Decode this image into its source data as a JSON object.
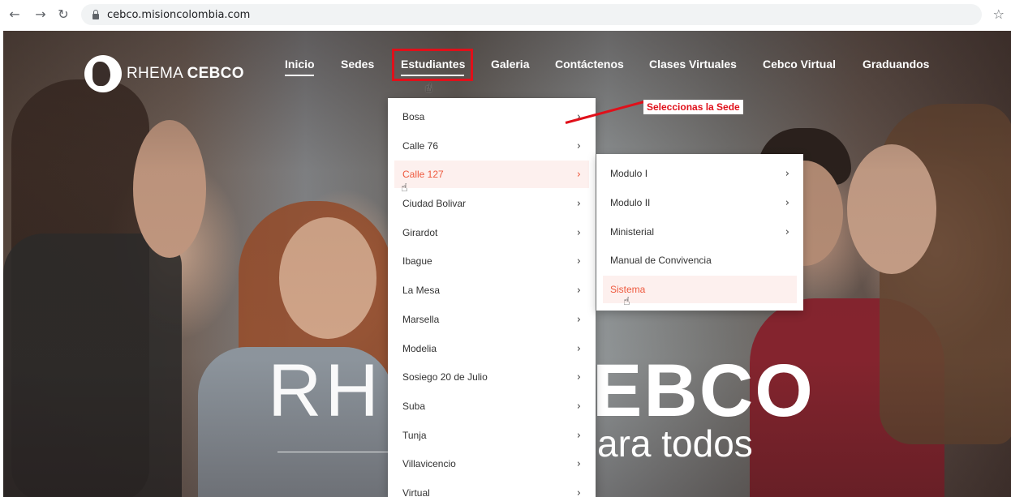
{
  "browser": {
    "back_icon": "back-arrow-icon",
    "forward_icon": "forward-arrow-icon",
    "reload_icon": "reload-icon",
    "url": "cebco.misioncolombia.com"
  },
  "header": {
    "logo_light": "RHEMA ",
    "logo_bold": "CEBCO",
    "nav": [
      {
        "label": "Inicio"
      },
      {
        "label": "Sedes"
      },
      {
        "label": "Estudiantes"
      },
      {
        "label": "Galeria"
      },
      {
        "label": "Contáctenos"
      },
      {
        "label": "Clases Virtuales"
      },
      {
        "label": "Cebco Virtual"
      },
      {
        "label": "Graduandos"
      }
    ]
  },
  "dropdown": {
    "items": [
      {
        "label": "Bosa"
      },
      {
        "label": "Calle 76"
      },
      {
        "label": "Calle 127"
      },
      {
        "label": "Ciudad Bolivar"
      },
      {
        "label": "Girardot"
      },
      {
        "label": "Ibague"
      },
      {
        "label": "La Mesa"
      },
      {
        "label": "Marsella"
      },
      {
        "label": "Modelia"
      },
      {
        "label": "Sosiego 20 de Julio"
      },
      {
        "label": "Suba"
      },
      {
        "label": "Tunja"
      },
      {
        "label": "Villavicencio"
      },
      {
        "label": "Virtual"
      }
    ],
    "active_index": 2,
    "chevron": "›"
  },
  "submenu": {
    "items": [
      {
        "label": "Modulo I",
        "has_arrow": true
      },
      {
        "label": "Modulo II",
        "has_arrow": true
      },
      {
        "label": "Ministerial",
        "has_arrow": true
      },
      {
        "label": "Manual de Convivencia",
        "has_arrow": false
      },
      {
        "label": "Sistema",
        "has_arrow": false
      }
    ],
    "active_index": 4
  },
  "annotation": {
    "text": "Seleccionas la Sede",
    "color": "#e0101a"
  },
  "hero": {
    "big_left": "RHE",
    "big_right": "EBCO",
    "subtitle": "ara todos"
  },
  "colors": {
    "accent": "#ee5a3f",
    "active_bg": "#fdf0ee",
    "annotation": "#e0101a"
  }
}
